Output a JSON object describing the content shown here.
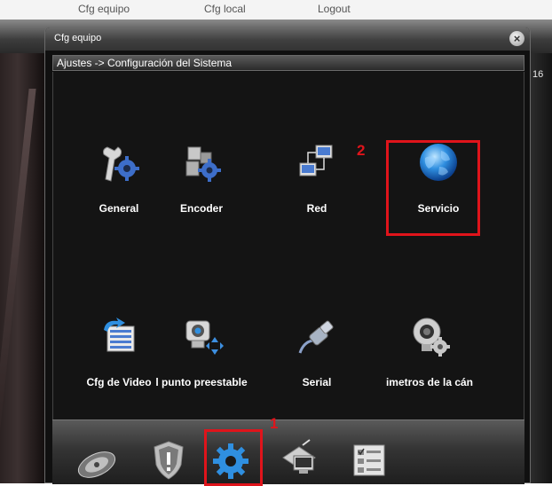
{
  "background": {
    "menu": [
      "Cfg equipo",
      "Cfg local",
      "Logout"
    ],
    "right_number": "16"
  },
  "dialog": {
    "title": "Cfg equipo",
    "breadcrumb": "Ajustes -> Configuración del Sistema"
  },
  "grid": {
    "items": [
      {
        "label": "General",
        "icon": "wrench-gear-icon"
      },
      {
        "label": "Encoder",
        "icon": "puzzle-gear-icon"
      },
      {
        "label": "Red",
        "icon": "network-icon"
      },
      {
        "label": "Servicio",
        "icon": "globe-icon"
      },
      {
        "label": "Cfg de Video",
        "icon": "video-list-icon"
      },
      {
        "label": "l punto preestable",
        "icon": "ptz-camera-icon"
      },
      {
        "label": "Serial",
        "icon": "serial-cable-icon"
      },
      {
        "label": "imetros de la cán",
        "icon": "webcam-gear-icon"
      }
    ]
  },
  "toolbar": {
    "items": [
      "disk-icon",
      "shield-icon",
      "gear-icon",
      "network-pc-icon",
      "checklist-icon"
    ]
  },
  "annotations": {
    "callout_1": "1",
    "callout_2": "2",
    "color": "#e0141b"
  }
}
